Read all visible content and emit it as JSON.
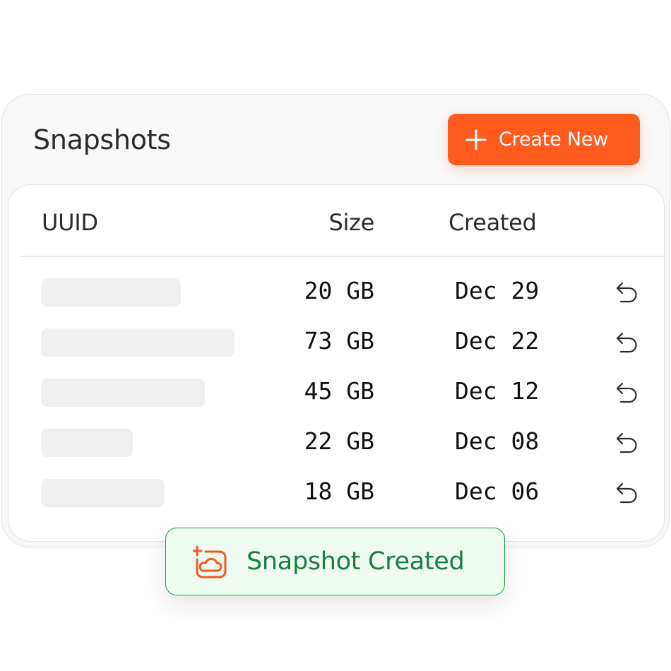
{
  "header": {
    "title": "Snapshots",
    "create_button": {
      "label": "Create New",
      "icon": "plus-icon"
    }
  },
  "table": {
    "columns": {
      "uuid": "UUID",
      "size": "Size",
      "created": "Created"
    },
    "rows": [
      {
        "uuid": "",
        "size": "20 GB",
        "created": "Dec 29",
        "action_icon": "restore-icon"
      },
      {
        "uuid": "",
        "size": "73 GB",
        "created": "Dec 22",
        "action_icon": "restore-icon"
      },
      {
        "uuid": "",
        "size": "45 GB",
        "created": "Dec 12",
        "action_icon": "restore-icon"
      },
      {
        "uuid": "",
        "size": "22 GB",
        "created": "Dec 08",
        "action_icon": "restore-icon"
      },
      {
        "uuid": "",
        "size": "18 GB",
        "created": "Dec 06",
        "action_icon": "restore-icon"
      }
    ]
  },
  "toast": {
    "message": "Snapshot Created",
    "icon": "add-cloud-snapshot-icon"
  },
  "colors": {
    "accent": "#ff5b1f",
    "success_text": "#16803c",
    "success_bg": "#effaf1",
    "success_border": "#1d9a4b"
  }
}
